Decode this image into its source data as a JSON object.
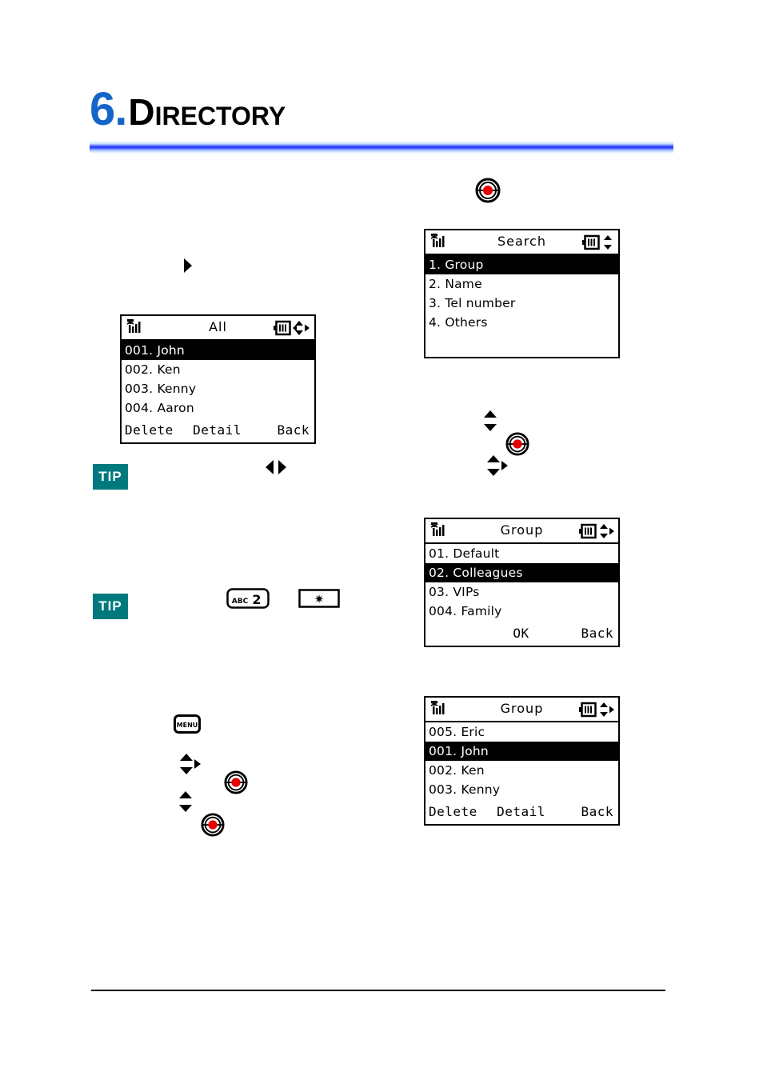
{
  "header": {
    "chapter_number": "6.",
    "chapter_title": "Directory"
  },
  "tips": [
    {
      "label": "TIP"
    },
    {
      "label": "TIP"
    }
  ],
  "key_icons": {
    "menu_key_label": "MENU",
    "key2_label": "2",
    "key2_letters": "ABC",
    "star_key_label": "✻"
  },
  "screens": [
    {
      "id": "screen-all",
      "title": "All",
      "status_left_icon": "signal-bars-icon",
      "status_right_icons": [
        "battery-icon",
        "nav-four-way-icon"
      ],
      "rows": [
        {
          "text": "001. John",
          "selected": true
        },
        {
          "text": "002. Ken",
          "selected": false
        },
        {
          "text": "003. Kenny",
          "selected": false
        },
        {
          "text": "004. Aaron",
          "selected": false
        }
      ],
      "softkeys": [
        "Delete",
        "Detail",
        "Back"
      ]
    },
    {
      "id": "screen-search",
      "title": "Search",
      "status_left_icon": "signal-bars-icon",
      "status_right_icons": [
        "battery-icon",
        "nav-up-down-icon"
      ],
      "rows": [
        {
          "text": "1. Group",
          "selected": true
        },
        {
          "text": "2. Name",
          "selected": false
        },
        {
          "text": "3. Tel number",
          "selected": false
        },
        {
          "text": "4. Others",
          "selected": false
        }
      ],
      "softkeys": [
        "",
        "",
        ""
      ]
    },
    {
      "id": "screen-group-list",
      "title": "Group",
      "status_left_icon": "signal-bars-icon",
      "status_right_icons": [
        "battery-icon",
        "nav-up-down-right-icon"
      ],
      "rows": [
        {
          "text": "01. Default",
          "selected": false
        },
        {
          "text": "02. Colleagues",
          "selected": true
        },
        {
          "text": "03. VIPs",
          "selected": false
        },
        {
          "text": "004. Family",
          "selected": false
        }
      ],
      "softkeys": [
        "",
        "OK",
        "Back"
      ]
    },
    {
      "id": "screen-group-members",
      "title": "Group",
      "status_left_icon": "signal-bars-icon",
      "status_right_icons": [
        "battery-icon",
        "nav-up-down-right-icon"
      ],
      "rows": [
        {
          "text": "005. Eric",
          "selected": false
        },
        {
          "text": "001. John",
          "selected": true
        },
        {
          "text": "002. Ken",
          "selected": false
        },
        {
          "text": "003. Kenny",
          "selected": false
        }
      ],
      "softkeys": [
        "Delete",
        "Detail",
        "Back"
      ]
    }
  ]
}
